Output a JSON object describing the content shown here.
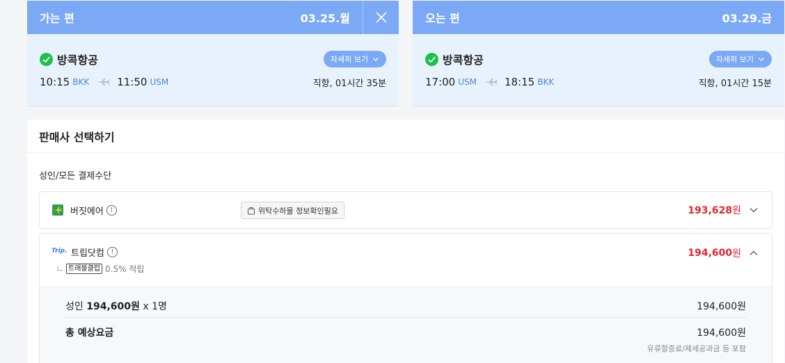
{
  "outbound": {
    "title": "가는 편",
    "date": "03.25.월",
    "airline": "방콕항공",
    "detail_btn": "자세히 보기",
    "dep_time": "10:15",
    "dep_code": "BKK",
    "arr_time": "11:50",
    "arr_code": "USM",
    "duration": "직항, 01시간 35분"
  },
  "return": {
    "title": "오는 편",
    "date": "03.29.금",
    "airline": "방콕항공",
    "detail_btn": "자세히 보기",
    "dep_time": "17:00",
    "dep_code": "USM",
    "arr_time": "18:15",
    "arr_code": "BKK",
    "duration": "직항, 01시간 15분"
  },
  "sellers": {
    "title": "판매사 선택하기",
    "section_label": "성인/모든 결제수단",
    "items": [
      {
        "name": "버짓에어",
        "notice": "위탁수하물 정보확인필요",
        "price": "193,628",
        "unit": "원"
      },
      {
        "logo_text": "Trip.",
        "name": "트립닷컴",
        "badge": "트래블클럽",
        "reward": "0.5% 적립",
        "price": "194,600",
        "unit": "원",
        "breakdown": {
          "adult_label": "성인",
          "adult_price": "194,600원",
          "adult_mult": "x 1명",
          "adult_total": "194,600원",
          "total_label": "총 예상요금",
          "total_value": "194,600원",
          "note": "유류할증료/제세공과금 등 포함"
        }
      }
    ]
  },
  "colors": {
    "header_blue": "#7ba9f6",
    "card_bg": "#e7f2fd",
    "price_red": "#e3262e",
    "airline_green": "#1fbf4a"
  }
}
